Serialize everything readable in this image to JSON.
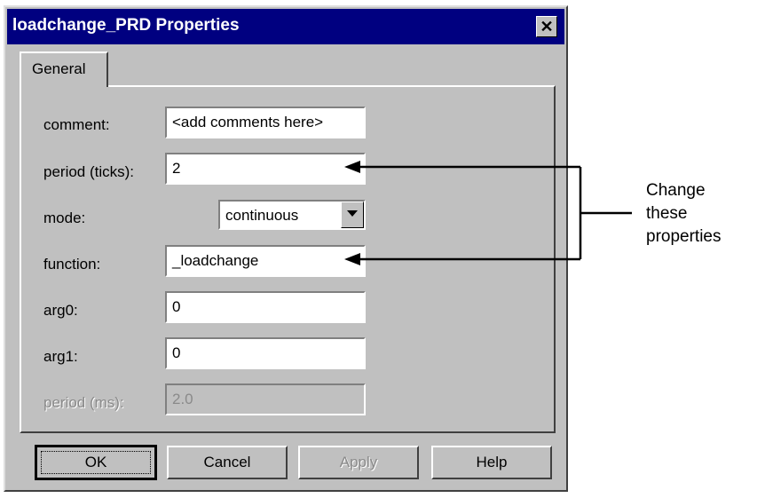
{
  "dialog": {
    "title": "loadchange_PRD Properties",
    "close_glyph": "✕",
    "tab": "General",
    "fields": {
      "comment": {
        "label": "comment:",
        "value": "<add comments here>"
      },
      "period_ticks": {
        "label": "period (ticks):",
        "value": "2"
      },
      "mode": {
        "label": "mode:",
        "value": "continuous"
      },
      "function": {
        "label": "function:",
        "value": "_loadchange"
      },
      "arg0": {
        "label": "arg0:",
        "value": "0"
      },
      "arg1": {
        "label": "arg1:",
        "value": "0"
      },
      "period_ms": {
        "label": "period (ms):",
        "value": "2.0",
        "disabled": true
      }
    },
    "buttons": {
      "ok": "OK",
      "cancel": "Cancel",
      "apply": "Apply",
      "help": "Help"
    }
  },
  "annotation": {
    "line1": "Change",
    "line2": "these",
    "line3": "properties"
  },
  "icons": {
    "close": "close-icon",
    "dropdown": "chevron-down-icon"
  }
}
